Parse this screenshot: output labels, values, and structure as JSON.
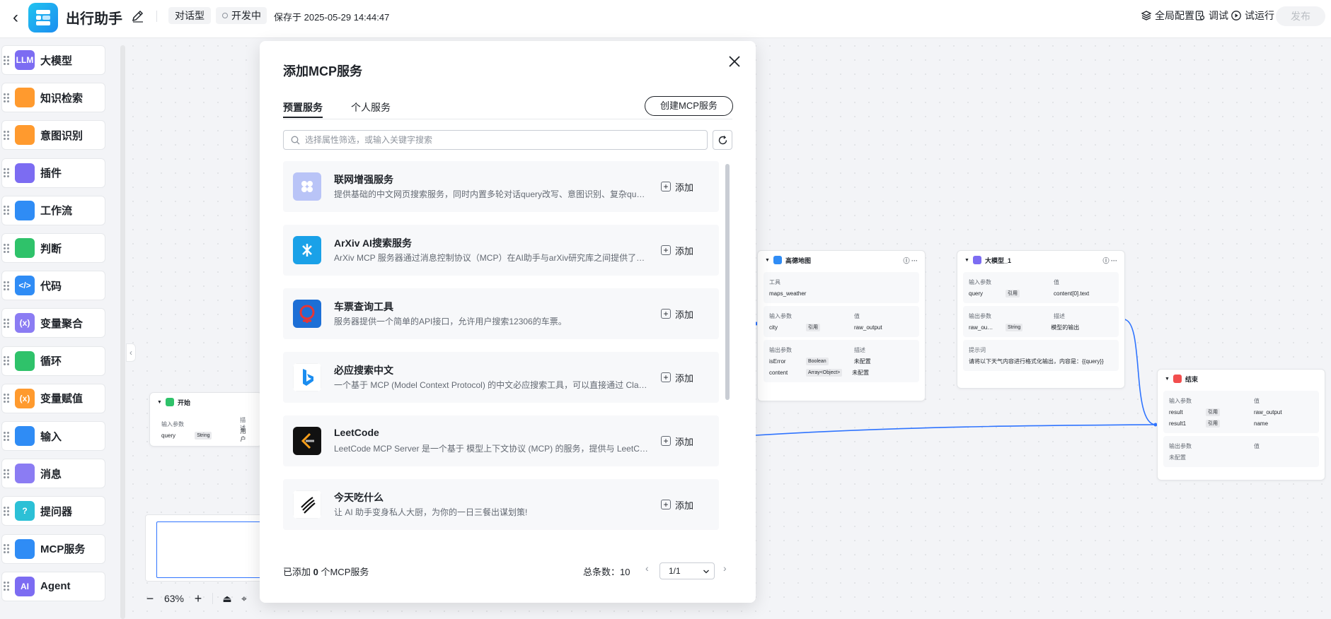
{
  "header": {
    "app_title": "出行助手",
    "type_tag": "对话型",
    "status_tag": "开发中",
    "save_text": "保存于 2025-05-29 14:44:47",
    "actions": {
      "global_config": "全局配置",
      "debug": "调试",
      "trial_run": "试运行"
    },
    "publish": "发布"
  },
  "sidebar": {
    "items": [
      {
        "label": "大模型",
        "icon": "llm-icon",
        "icon_text": "LLM",
        "color": "#7c6cf2"
      },
      {
        "label": "知识检索",
        "icon": "book-icon",
        "icon_text": "",
        "color": "#ff9a2e"
      },
      {
        "label": "意图识别",
        "icon": "person-star-icon",
        "icon_text": "",
        "color": "#ff9a2e"
      },
      {
        "label": "插件",
        "icon": "puzzle-icon",
        "icon_text": "",
        "color": "#7c6cf2"
      },
      {
        "label": "工作流",
        "icon": "workflow-icon",
        "icon_text": "",
        "color": "#2f8cf5"
      },
      {
        "label": "判断",
        "icon": "branch-icon",
        "icon_text": "",
        "color": "#2fc26a"
      },
      {
        "label": "代码",
        "icon": "code-icon",
        "icon_text": "</>",
        "color": "#2f8cf5"
      },
      {
        "label": "变量聚合",
        "icon": "variable-icon",
        "icon_text": "(x)",
        "color": "#8b7cf3"
      },
      {
        "label": "循环",
        "icon": "loop-icon",
        "icon_text": "",
        "color": "#2fc26a"
      },
      {
        "label": "变量赋值",
        "icon": "assign-icon",
        "icon_text": "(x)",
        "color": "#ff9a2e"
      },
      {
        "label": "输入",
        "icon": "input-icon",
        "icon_text": "",
        "color": "#2f8cf5"
      },
      {
        "label": "消息",
        "icon": "message-icon",
        "icon_text": "",
        "color": "#8b7cf3"
      },
      {
        "label": "提问器",
        "icon": "question-icon",
        "icon_text": "?",
        "color": "#2cc0d6"
      },
      {
        "label": "MCP服务",
        "icon": "mcp-icon",
        "icon_text": "",
        "color": "#2f8cf5"
      },
      {
        "label": "Agent",
        "icon": "agent-icon",
        "icon_text": "AI",
        "color": "#7c6cf2"
      }
    ]
  },
  "canvas": {
    "zoom": "63%",
    "nodes": {
      "start": {
        "title": "开始",
        "inputs_label": "输入参数",
        "desc_label": "描述",
        "param": "query",
        "type": "String",
        "desc": "用户"
      },
      "map": {
        "title": "高德地图",
        "tool_label": "工具",
        "tool": "maps_weather",
        "inputs_label": "输入参数",
        "value_label": "值",
        "in_param": "city",
        "in_ref": "引用",
        "in_value": "raw_output",
        "outputs_label": "输出参数",
        "desc_label": "描述",
        "out1": "isError",
        "out1_type": "Boolean",
        "out1_desc": "未配置",
        "out2": "content",
        "out2_type": "Array<Object>",
        "out2_desc": "未配置"
      },
      "llm": {
        "title": "大模型_1",
        "inputs_label": "输入参数",
        "value_label": "值",
        "in_param": "query",
        "in_ref": "引用",
        "in_value": "content[0].text",
        "outputs_label": "输出参数",
        "desc_label": "描述",
        "out_param": "raw_ou…",
        "out_type": "String",
        "out_desc": "模型的输出",
        "prompt_label": "提示词",
        "prompt": "请将以下天气内容进行格式化输出，内容是：{{query}}"
      },
      "end": {
        "title": "结束",
        "inputs_label": "输入参数",
        "value_label": "值",
        "r1": "result",
        "r1_ref": "引用",
        "r1_value": "raw_output",
        "r2": "result1",
        "r2_ref": "引用",
        "r2_value": "name",
        "outputs_label": "输出参数",
        "out_value_label": "值",
        "out_none": "未配置"
      }
    }
  },
  "modal": {
    "title": "添加MCP服务",
    "tabs": [
      {
        "label": "预置服务"
      },
      {
        "label": "个人服务"
      }
    ],
    "create_button": "创建MCP服务",
    "search_placeholder": "选择属性筛选，或输入关键字搜索",
    "add_label": "添加",
    "services": [
      {
        "name": "联网增强服务",
        "desc": "提供基础的中文网页搜索服务，同时内置多轮对话query改写、意图识别、复杂query拆解等能力",
        "icon": "web-search-icon"
      },
      {
        "name": "ArXiv AI搜索服务",
        "desc": "ArXiv MCP 服务器通过消息控制协议（MCP）在AI助手与arXiv研究库之间提供了桥梁",
        "icon": "arxiv-icon"
      },
      {
        "name": "车票查询工具",
        "desc": "服务器提供一个简单的API接口，允许用户搜索12306的车票。",
        "icon": "train-ticket-icon"
      },
      {
        "name": "必应搜索中文",
        "desc": "一个基于 MCP (Model Context Protocol) 的中文必应搜索工具，可以直接通过 Claude 或其他工具调用",
        "icon": "bing-icon"
      },
      {
        "name": "LeetCode",
        "desc": "LeetCode MCP Server 是一个基于 模型上下文协议 (MCP) 的服务，提供与 LeetCode 平台交互的能力",
        "icon": "leetcode-icon"
      },
      {
        "name": "今天吃什么",
        "desc": "让 AI 助手变身私人大厨，为你的一日三餐出谋划策!",
        "icon": "chef-icon"
      }
    ],
    "footer": {
      "added_prefix": "已添加 ",
      "added_count": "0",
      "added_suffix": " 个MCP服务",
      "total": "总条数：10",
      "page": "1/1"
    }
  }
}
